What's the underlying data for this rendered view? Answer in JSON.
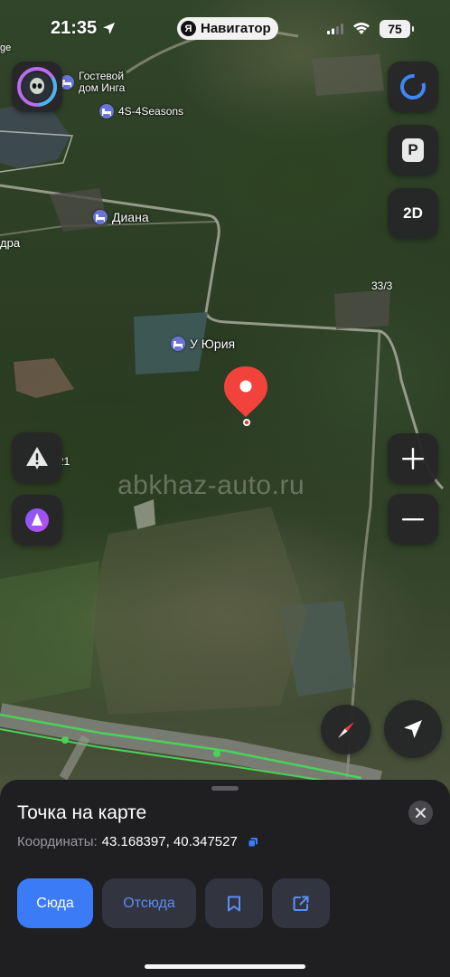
{
  "status_bar": {
    "time": "21:35",
    "app_name": "Навигатор",
    "app_logo_letter": "Я",
    "battery": "75"
  },
  "map": {
    "pois": [
      {
        "label": "Гостевой\nдом Инга"
      },
      {
        "label": "4S-4Seasons"
      },
      {
        "label": "Диана"
      },
      {
        "label": "У Юрия"
      }
    ],
    "edge_labels": [
      "ge",
      "дра",
      "33/3",
      "21"
    ],
    "watermark": "abkhaz-auto.ru",
    "mode_button": "2D",
    "parking_button": "P"
  },
  "sheet": {
    "title": "Точка на карте",
    "coords_label": "Координаты:",
    "coords_value": "43.168397, 40.347527",
    "actions": {
      "here": "Сюда",
      "from": "Отсюда"
    }
  },
  "colors": {
    "accent": "#3b7cf6",
    "pin": "#f1433b",
    "route": "#4bd15a",
    "sheet_bg": "#1f1f21",
    "button_bg": "#262628"
  },
  "icons": [
    "alice-avatar-icon",
    "alice-assistant-icon",
    "parking-icon",
    "incident-warning-icon",
    "zoom-in-icon",
    "zoom-out-icon",
    "compass-icon",
    "locate-me-icon",
    "close-icon",
    "copy-icon",
    "bookmark-icon",
    "share-icon",
    "hotel-icon",
    "location-pin-icon"
  ]
}
